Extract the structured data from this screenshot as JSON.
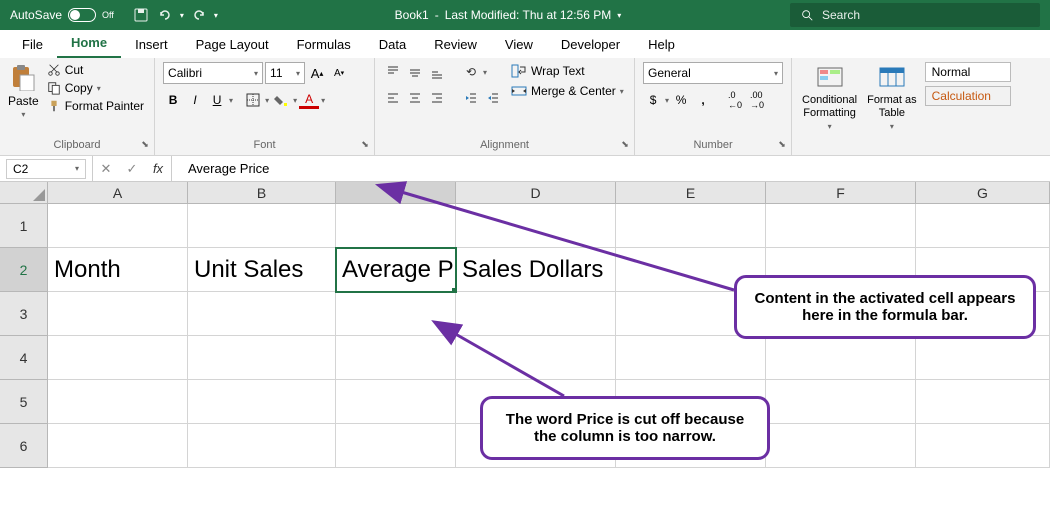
{
  "titlebar": {
    "autosave": "AutoSave",
    "autosave_state": "Off",
    "doc": "Book1",
    "modified": "Last Modified: Thu at 12:56 PM",
    "search_ph": "Search"
  },
  "menu": {
    "file": "File",
    "home": "Home",
    "insert": "Insert",
    "layout": "Page Layout",
    "formulas": "Formulas",
    "data": "Data",
    "review": "Review",
    "view": "View",
    "developer": "Developer",
    "help": "Help"
  },
  "ribbon": {
    "clipboard": {
      "paste": "Paste",
      "cut": "Cut",
      "copy": "Copy",
      "painter": "Format Painter",
      "label": "Clipboard"
    },
    "font": {
      "name": "Calibri",
      "size": "11",
      "label": "Font"
    },
    "alignment": {
      "wrap": "Wrap Text",
      "merge": "Merge & Center",
      "label": "Alignment"
    },
    "number": {
      "type": "General",
      "label": "Number"
    },
    "styles": {
      "cond": "Conditional\nFormatting",
      "fmt": "Format as\nTable",
      "normal": "Normal",
      "calc": "Calculation"
    }
  },
  "namebox": "C2",
  "formula": "Average Price",
  "columns": [
    "A",
    "B",
    "C",
    "D",
    "E",
    "F",
    "G"
  ],
  "rows": [
    "1",
    "2",
    "3",
    "4",
    "5",
    "6"
  ],
  "cells": {
    "A2": "Month",
    "B2": "Unit Sales",
    "C2": "Average Pr",
    "D2": "Sales Dollars"
  },
  "callouts": {
    "c1": "Content in the activated cell appears here in the formula bar.",
    "c2": "The word Price is cut off because the column is too narrow."
  }
}
